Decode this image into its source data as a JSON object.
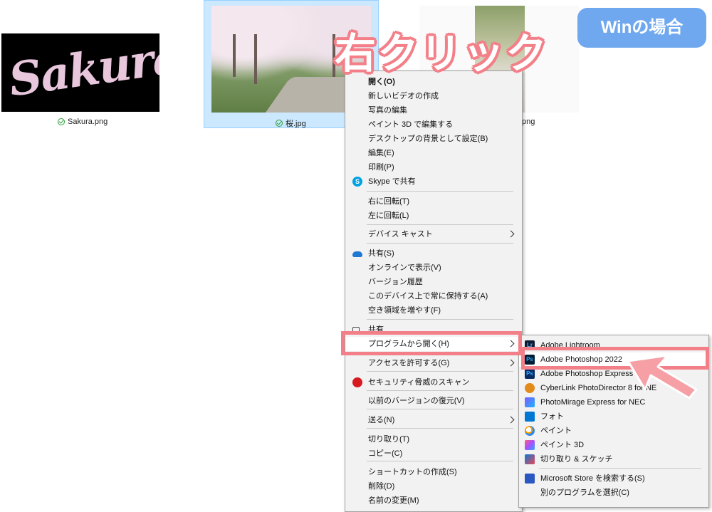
{
  "files": [
    {
      "thumb_text": "Sakura",
      "name": "Sakura.png",
      "synced": true
    },
    {
      "name": "桜.jpg",
      "synced": true,
      "selected": true
    },
    {
      "name": "png",
      "synced": false
    }
  ],
  "callout": {
    "title": "右クリック",
    "badge": "Winの場合",
    "accent_color": "#f37f88",
    "badge_color": "#6fa8ee"
  },
  "context_menu": {
    "items": [
      {
        "label": "開く(O)",
        "bold": true
      },
      {
        "label": "新しいビデオの作成"
      },
      {
        "label": "写真の編集"
      },
      {
        "label": "ペイント 3D で編集する"
      },
      {
        "label": "デスクトップの背景として設定(B)"
      },
      {
        "label": "編集(E)"
      },
      {
        "label": "印刷(P)"
      },
      {
        "label": "Skype で共有",
        "icon": "skype-icon"
      },
      {
        "label": "右に回転(T)"
      },
      {
        "label": "左に回転(L)"
      },
      {
        "label": "デバイス キャスト",
        "submenu": true
      },
      {
        "label": "共有(S)",
        "icon": "onedrive-icon"
      },
      {
        "label": "オンラインで表示(V)"
      },
      {
        "label": "バージョン履歴"
      },
      {
        "label": "このデバイス上で常に保持する(A)"
      },
      {
        "label": "空き領域を増やす(F)"
      },
      {
        "label": "共有",
        "icon": "share-icon"
      },
      {
        "label": "プログラムから開く(H)",
        "submenu": true,
        "highlighted": true
      },
      {
        "label": "アクセスを許可する(G)",
        "submenu": true
      },
      {
        "label": "セキュリティ脅威のスキャン",
        "icon": "trend-micro-icon"
      },
      {
        "label": "以前のバージョンの復元(V)"
      },
      {
        "label": "送る(N)",
        "submenu": true
      },
      {
        "label": "切り取り(T)"
      },
      {
        "label": "コピー(C)"
      },
      {
        "label": "ショートカットの作成(S)"
      },
      {
        "label": "削除(D)"
      },
      {
        "label": "名前の変更(M)"
      }
    ]
  },
  "open_with_menu": {
    "items": [
      {
        "label": "Adobe Lightroom",
        "icon": "lightroom-icon",
        "glyph": "Lr"
      },
      {
        "label": "Adobe Photoshop 2022",
        "icon": "photoshop-icon",
        "glyph": "Ps",
        "highlighted": true
      },
      {
        "label": "Adobe Photoshop Express",
        "icon": "photoshop-express-icon",
        "glyph": "Ps"
      },
      {
        "label": "CyberLink PhotoDirector 8 for NE",
        "icon": "photodirector-icon",
        "glyph": ""
      },
      {
        "label": "PhotoMirage Express for NEC",
        "icon": "photomirage-icon",
        "glyph": ""
      },
      {
        "label": "フォト",
        "icon": "photos-icon",
        "glyph": ""
      },
      {
        "label": "ペイント",
        "icon": "paint-icon",
        "glyph": ""
      },
      {
        "label": "ペイント 3D",
        "icon": "paint3d-icon",
        "glyph": ""
      },
      {
        "label": "切り取り & スケッチ",
        "icon": "snip-sketch-icon",
        "glyph": ""
      },
      {
        "label": "Microsoft Store を検索する(S)",
        "icon": "store-icon",
        "glyph": ""
      },
      {
        "label": "別のプログラムを選択(C)"
      }
    ]
  }
}
